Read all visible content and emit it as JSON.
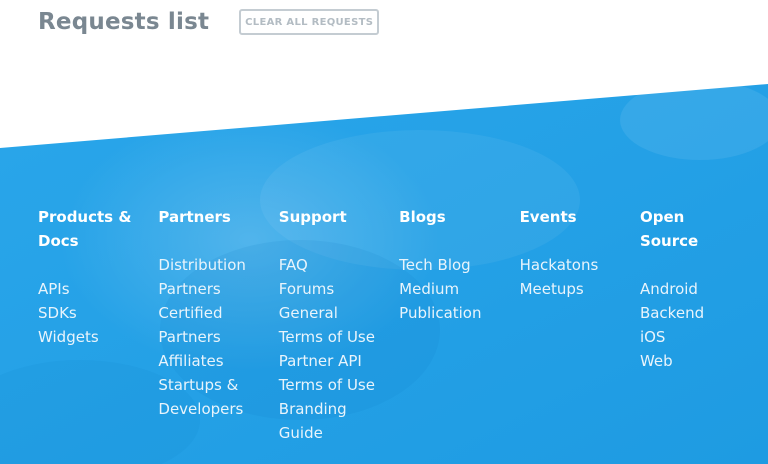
{
  "header": {
    "title": "Requests list",
    "clear_button": "CLEAR ALL REQUESTS"
  },
  "colors": {
    "footer_blue": "#1e9be2",
    "footer_blue_light": "#2aa6ea",
    "title_gray": "#7a8791",
    "button_border": "#c4ccd2"
  },
  "footer": {
    "columns": [
      {
        "title": "Products &\nDocs",
        "links": [
          "APIs",
          "SDKs",
          "Widgets"
        ]
      },
      {
        "title": "Partners",
        "links": [
          "Distribution",
          "Partners",
          "Certified",
          "Partners",
          "Affiliates",
          "Startups &",
          "Developers"
        ]
      },
      {
        "title": "Support",
        "links": [
          "FAQ",
          "Forums",
          "General",
          "Terms of Use",
          "Partner API",
          "Terms of Use",
          "Branding",
          "Guide"
        ]
      },
      {
        "title": "Blogs",
        "links": [
          "Tech Blog",
          "Medium",
          "Publication"
        ]
      },
      {
        "title": "Events",
        "links": [
          "Hackatons",
          "Meetups"
        ]
      },
      {
        "title": "Open\nSource",
        "links": [
          "Android",
          "Backend",
          "iOS",
          "Web"
        ]
      }
    ]
  }
}
